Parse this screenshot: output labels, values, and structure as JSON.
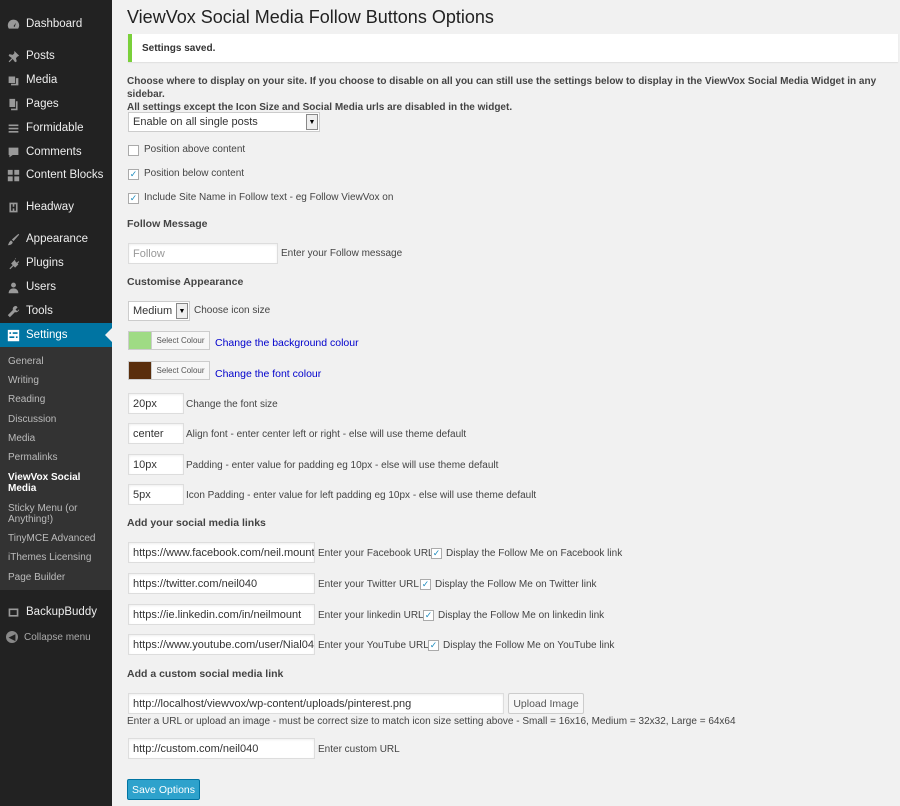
{
  "sidebar": {
    "menu": [
      {
        "label": "Dashboard",
        "icon": "dashboard-icon"
      },
      {
        "label": "Posts",
        "icon": "pin-icon"
      },
      {
        "label": "Media",
        "icon": "media-icon"
      },
      {
        "label": "Pages",
        "icon": "pages-icon"
      },
      {
        "label": "Formidable",
        "icon": "list-icon"
      },
      {
        "label": "Comments",
        "icon": "comment-icon"
      },
      {
        "label": "Content Blocks",
        "icon": "blocks-icon"
      },
      {
        "label": "Headway",
        "icon": "headway-icon"
      },
      {
        "label": "Appearance",
        "icon": "brush-icon"
      },
      {
        "label": "Plugins",
        "icon": "plug-icon"
      },
      {
        "label": "Users",
        "icon": "user-icon"
      },
      {
        "label": "Tools",
        "icon": "wrench-icon"
      },
      {
        "label": "Settings",
        "icon": "settings-icon"
      },
      {
        "label": "BackupBuddy",
        "icon": "backup-icon"
      }
    ],
    "submenu": [
      "General",
      "Writing",
      "Reading",
      "Discussion",
      "Media",
      "Permalinks",
      "ViewVox Social Media",
      "Sticky Menu (or Anything!)",
      "TinyMCE Advanced",
      "iThemes Licensing",
      "Page Builder"
    ],
    "collapse": "Collapse menu"
  },
  "page": {
    "title": "ViewVox Social Media Follow Buttons Options",
    "notice": "Settings saved.",
    "intro_line1": "Choose where to display on your site. If you choose to disable on all you can still use the settings below to display in the ViewVox Social Media Widget in any sidebar.",
    "intro_line2": "All settings except the Icon Size and Social Media urls are disabled in the widget.",
    "display_select": "Enable on all single posts",
    "checkboxes": [
      {
        "label": "Position above content",
        "checked": false
      },
      {
        "label": "Position below content",
        "checked": true
      },
      {
        "label": "Include Site Name in Follow text - eg Follow ViewVox on",
        "checked": true
      }
    ],
    "follow_message_heading": "Follow Message",
    "follow_message_placeholder": "Follow",
    "follow_message_label": "Enter your Follow message",
    "customise_heading": "Customise Appearance",
    "icon_size_select": "Medium",
    "icon_size_label": "Choose icon size",
    "select_colour_label": "Select Colour",
    "bg_colour": "#9fdb84",
    "bg_colour_link": "Change the background colour",
    "font_colour": "#5a2e0c",
    "font_colour_link": "Change the font colour",
    "font_size_value": "20px",
    "font_size_label": "Change the font size",
    "align_value": "center",
    "align_label": "Align font - enter center left or right - else will use theme default",
    "padding_value": "10px",
    "padding_label": "Padding - enter value for padding eg 10px - else will use theme default",
    "icon_padding_value": "5px",
    "icon_padding_label": "Icon Padding - enter value for left padding eg 10px - else will use theme default",
    "social_heading": "Add your social media links",
    "social": [
      {
        "url": "https://www.facebook.com/neil.mount",
        "label": "Enter your Facebook URL",
        "check_label": "Display the Follow Me on Facebook link"
      },
      {
        "url": "https://twitter.com/neil040",
        "label": "Enter your Twitter URL",
        "check_label": "Display the Follow Me on Twitter link"
      },
      {
        "url": "https://ie.linkedin.com/in/neilmount",
        "label": "Enter your linkedin URL",
        "check_label": "Display the Follow Me on linkedin link"
      },
      {
        "url": "https://www.youtube.com/user/Nial04",
        "label": "Enter your YouTube URL",
        "check_label": "Display the Follow Me on YouTube link"
      }
    ],
    "custom_heading": "Add a custom social media link",
    "custom_image_url": "http://localhost/viewvox/wp-content/uploads/pinterest.png",
    "upload_button": "Upload Image",
    "custom_hint": "Enter a URL or upload an image - must be correct size to match icon size setting above - Small = 16x16, Medium = 32x32, Large = 64x64",
    "custom_url": "http://custom.com/neil040",
    "custom_url_label": "Enter custom URL",
    "save_button": "Save Options"
  }
}
